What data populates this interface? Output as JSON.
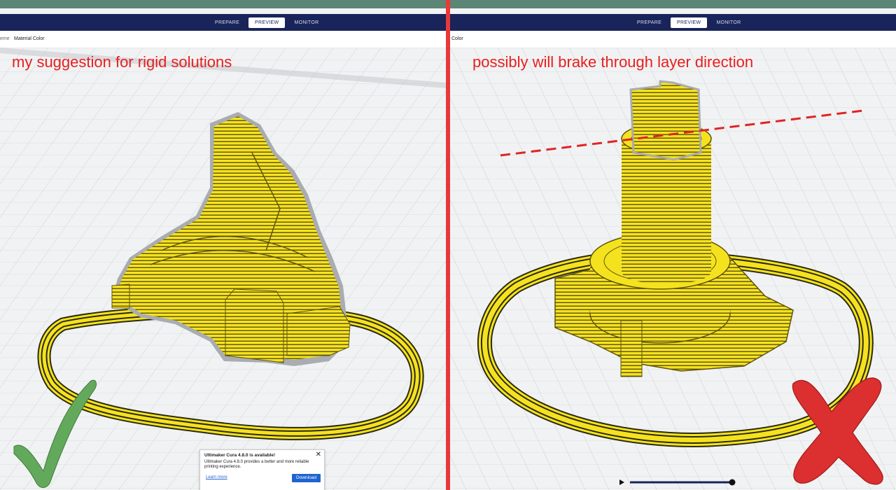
{
  "left": {
    "tabs": [
      {
        "label": "PREPARE"
      },
      {
        "label": "PREVIEW"
      },
      {
        "label": "MONITOR"
      }
    ],
    "active_tab": "PREVIEW",
    "subbar": {
      "prefix": "eme",
      "label": "Material Color"
    },
    "annotation": "my suggestion for rigid solutions",
    "notification": {
      "title": "Ultimaker Cura 4.8.0 is available!",
      "body": "Ultimaker Cura 4.8.0 provides a better and more reliable printing experience.",
      "learn_more": "Learn more",
      "download": "Download",
      "close": "✕"
    }
  },
  "right": {
    "tabs": [
      {
        "label": "PREPARE"
      },
      {
        "label": "PREVIEW"
      },
      {
        "label": "MONITOR"
      }
    ],
    "active_tab": "PREVIEW",
    "subbar": {
      "label": "Color"
    },
    "annotation": "possibly will brake through layer direction"
  },
  "colors": {
    "header": "#19245a",
    "top_strip": "#5b8574",
    "divider": "#e8383a",
    "annotation": "#e71f1f",
    "print": "#f5e21f",
    "check": "#63a95c",
    "cross": "#dc2f2f"
  },
  "icons": {
    "success": "check-mark-icon",
    "failure": "cross-mark-icon",
    "play": "play-icon",
    "close": "close-icon"
  }
}
